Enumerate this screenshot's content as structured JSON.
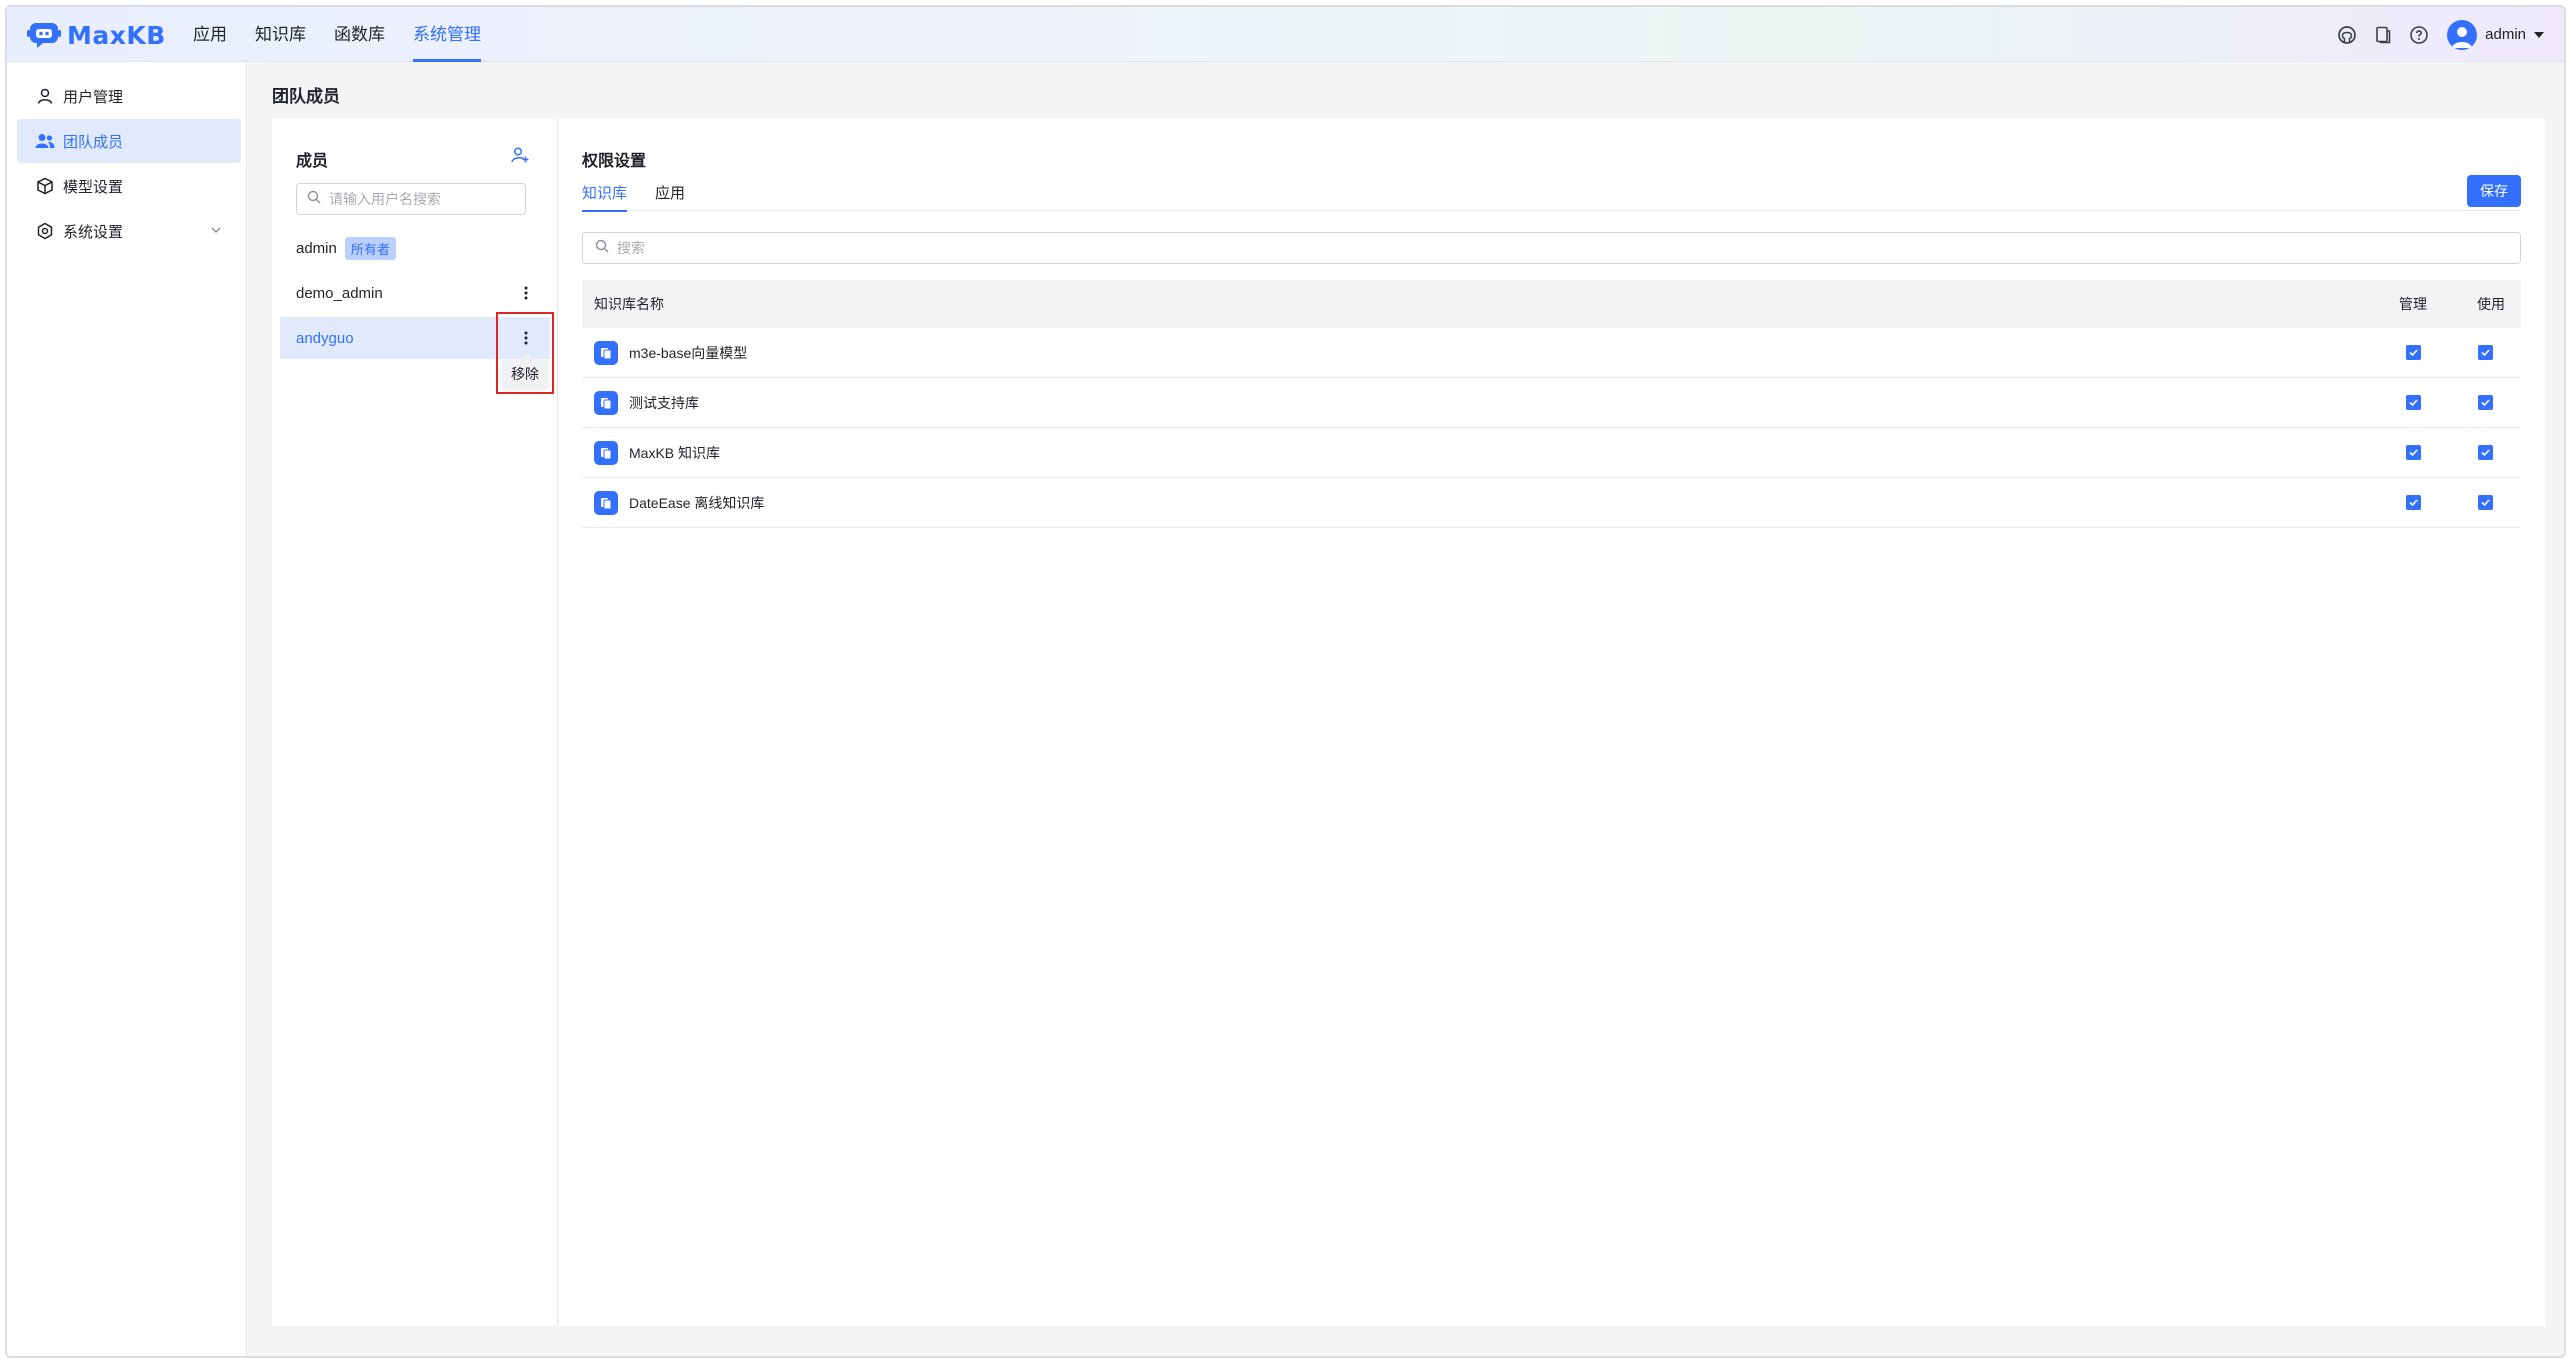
{
  "app": {
    "logo_text": "MaxKB"
  },
  "nav": {
    "items": [
      {
        "label": "应用"
      },
      {
        "label": "知识库"
      },
      {
        "label": "函数库"
      },
      {
        "label": "系统管理"
      }
    ],
    "active": "系统管理"
  },
  "header": {
    "icons": [
      "github-icon",
      "docs-icon",
      "help-icon"
    ],
    "user_name": "admin"
  },
  "sidebar": {
    "items": [
      {
        "label": "用户管理",
        "icon": "user-icon"
      },
      {
        "label": "团队成员",
        "icon": "team-icon"
      },
      {
        "label": "模型设置",
        "icon": "cube-icon"
      },
      {
        "label": "系统设置",
        "icon": "gear-icon"
      }
    ],
    "active": "团队成员"
  },
  "page": {
    "title": "团队成员"
  },
  "members": {
    "title": "成员",
    "search_placeholder": "请输入用户名搜索",
    "list": [
      {
        "name": "admin",
        "tag": "所有者"
      },
      {
        "name": "demo_admin"
      },
      {
        "name": "andyguo"
      }
    ],
    "selected": "andyguo",
    "menu_item": "移除"
  },
  "permissions": {
    "title": "权限设置",
    "tabs": [
      {
        "label": "知识库"
      },
      {
        "label": "应用"
      }
    ],
    "active_tab": "知识库",
    "save_label": "保存",
    "search_placeholder": "搜索",
    "columns": {
      "name": "知识库名称",
      "manage": "管理",
      "use": "使用"
    },
    "rows": [
      {
        "name": "m3e-base向量模型",
        "manage": true,
        "use": true
      },
      {
        "name": "测试支持库",
        "manage": true,
        "use": true
      },
      {
        "name": "MaxKB 知识库",
        "manage": true,
        "use": true
      },
      {
        "name": "DateEase 离线知识库",
        "manage": true,
        "use": true
      }
    ]
  },
  "colors": {
    "accent": "#3370ff",
    "highlight": "#e02525"
  }
}
